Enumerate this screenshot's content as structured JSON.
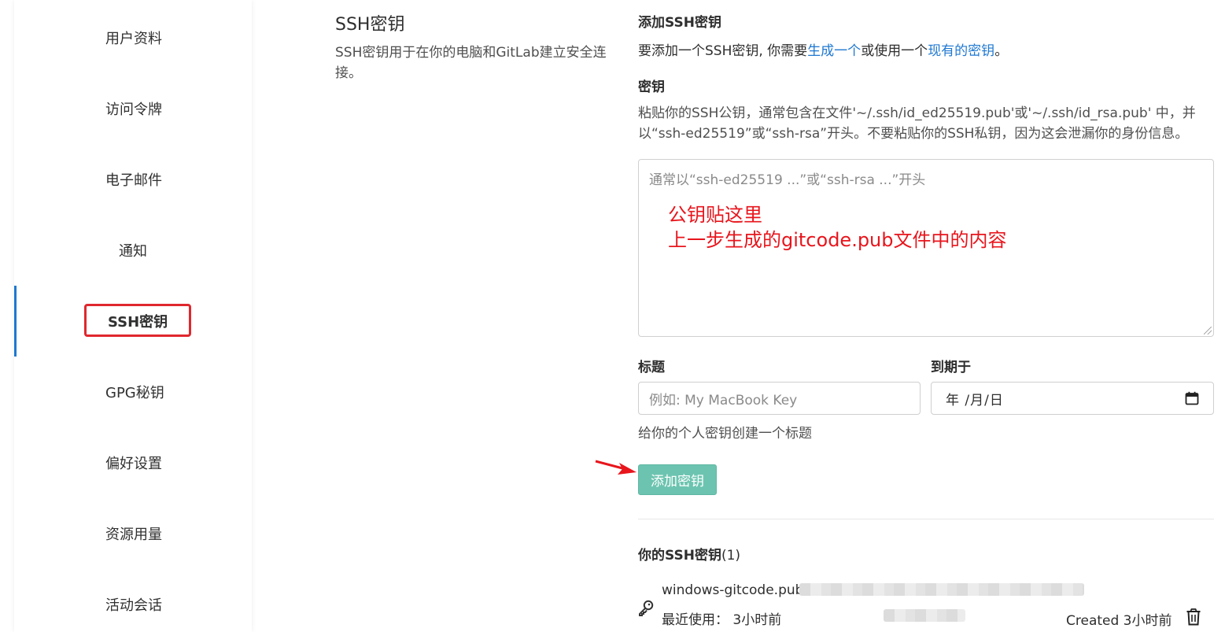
{
  "sidebar": {
    "items": [
      {
        "label": "用户资料"
      },
      {
        "label": "访问令牌"
      },
      {
        "label": "电子邮件"
      },
      {
        "label": "通知"
      },
      {
        "label": "SSH密钥",
        "active": true
      },
      {
        "label": "GPG秘钥"
      },
      {
        "label": "偏好设置"
      },
      {
        "label": "资源用量"
      },
      {
        "label": "活动会话"
      }
    ]
  },
  "section": {
    "title": "SSH密钥",
    "description": "SSH密钥用于在你的电脑和GitLab建立安全连接。"
  },
  "form": {
    "add_heading": "添加SSH密钥",
    "add_intro_prefix": "要添加一个SSH密钥, 你需要",
    "add_intro_link1": "生成一个",
    "add_intro_middle": "或使用一个",
    "add_intro_link2": "现有的密钥",
    "add_intro_suffix": "。",
    "key_label": "密钥",
    "key_help": "粘贴你的SSH公钥，通常包含在文件'~/.ssh/id_ed25519.pub'或'~/.ssh/id_rsa.pub' 中，并以“ssh-ed25519”或“ssh-rsa”开头。不要粘贴你的SSH私钥，因为这会泄漏你的身份信息。",
    "key_placeholder": "通常以“ssh-ed25519 ...”或“ssh-rsa ...”开头",
    "annotation_line1": "公钥贴这里",
    "annotation_line2": "上一步生成的gitcode.pub文件中的内容",
    "title_label": "标题",
    "title_placeholder": "例如: My MacBook Key",
    "title_help": "给你的个人密钥创建一个标题",
    "expires_label": "到期于",
    "expires_value": "年 /月/日",
    "submit_label": "添加密钥"
  },
  "keys": {
    "heading": "你的SSH密钥",
    "count": "(1)",
    "items": [
      {
        "name": "windows-gitcode.pub",
        "last_used_label": "最近使用：",
        "last_used_value": "3小时前",
        "created": "Created 3小时前"
      }
    ]
  },
  "colors": {
    "accent_link": "#1f78d1",
    "active_bar": "#1f78d1",
    "submit_button": "#6cc4b0",
    "annotation_red": "#e8151c"
  }
}
